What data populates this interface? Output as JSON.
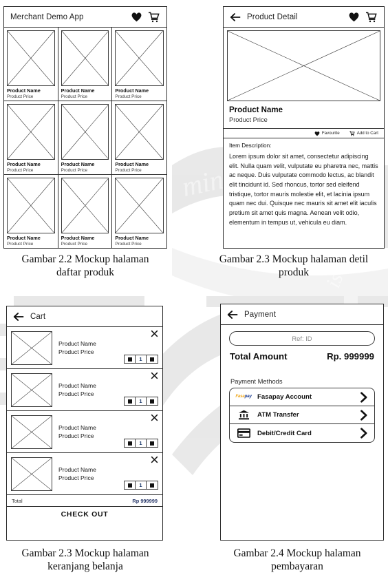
{
  "figures": [
    {
      "id": "products",
      "caption_line1": "Gambar 2.2 Mockup halaman",
      "caption_line2": "daftar produk"
    },
    {
      "id": "detail",
      "caption_line1": "Gambar 2.3 Mockup halaman detil",
      "caption_line2": "produk"
    },
    {
      "id": "cart",
      "caption_line1": "Gambar 2.3 Mockup halaman",
      "caption_line2": "keranjang belanja"
    },
    {
      "id": "payment",
      "caption_line1": "Gambar 2.4 Mockup halaman",
      "caption_line2": "pembayaran"
    }
  ],
  "products_page": {
    "app_title": "Merchant Demo App",
    "icons": {
      "favorite": "heart-icon",
      "cart": "cart-icon"
    },
    "items": [
      {
        "name": "Product Name",
        "price": "Product Price"
      },
      {
        "name": "Product Name",
        "price": "Product Price"
      },
      {
        "name": "Product Name",
        "price": "Product Price"
      },
      {
        "name": "Product Name",
        "price": "Product Price"
      },
      {
        "name": "Product Name",
        "price": "Product Price"
      },
      {
        "name": "Product Name",
        "price": "Product Price"
      },
      {
        "name": "Product Name",
        "price": "Product Price"
      },
      {
        "name": "Product Name",
        "price": "Product Price"
      },
      {
        "name": "Product Name",
        "price": "Product Price"
      }
    ]
  },
  "detail_page": {
    "app_title": "Product Detail",
    "icons": {
      "back": "back-arrow-icon",
      "favorite": "heart-icon",
      "cart": "cart-icon"
    },
    "product_name": "Product Name",
    "product_price": "Product Price",
    "actions": [
      {
        "label": "Favourite",
        "icon": "heart-icon"
      },
      {
        "label": "Add to Cart",
        "icon": "cart-icon"
      }
    ],
    "description_label": "Item Description:",
    "description_body": "Lorem ipsum dolor sit amet, consectetur adipiscing elit. Nulla quam velit, vulputate eu pharetra nec, mattis ac neque. Duis vulputate commodo lectus, ac blandit elit tincidunt id. Sed rhoncus, tortor sed eleifend tristique, tortor mauris molestie elit, et lacinia ipsum quam nec dui. Quisque nec mauris sit amet elit iaculis pretium sit amet quis magna. Aenean velit odio, elementum in tempus ut, vehicula eu diam."
  },
  "cart_page": {
    "app_title": "Cart",
    "icons": {
      "back": "back-arrow-icon"
    },
    "items": [
      {
        "name": "Product Name",
        "price": "Product Price",
        "qty": "1"
      },
      {
        "name": "Product Name",
        "price": "Product Price",
        "qty": "1"
      },
      {
        "name": "Product Name",
        "price": "Product Price",
        "qty": "1"
      },
      {
        "name": "Product Name",
        "price": "Product Price",
        "qty": "1"
      }
    ],
    "total_label": "Total",
    "total_value": "Rp 999999",
    "checkout_label": "CHECK OUT"
  },
  "payment_page": {
    "app_title": "Payment",
    "icons": {
      "back": "back-arrow-icon"
    },
    "ref_placeholder": "Ref: ID",
    "total_label": "Total Amount",
    "total_value": "Rp. 999999",
    "methods_label": "Payment Methods",
    "methods": [
      {
        "name": "Fasapay Account",
        "icon": "fasapay-logo-icon",
        "logo_a": "Fasa",
        "logo_b": "pay"
      },
      {
        "name": "ATM Transfer",
        "icon": "bank-building-icon"
      },
      {
        "name": "Debit/Credit Card",
        "icon": "credit-card-icon"
      }
    ]
  },
  "colors": {
    "frame": "#2b2b2b",
    "text": "#111111",
    "muted": "#8d8d8d",
    "accent_blue": "#1b3a8f",
    "accent_orange": "#f0a81e"
  }
}
